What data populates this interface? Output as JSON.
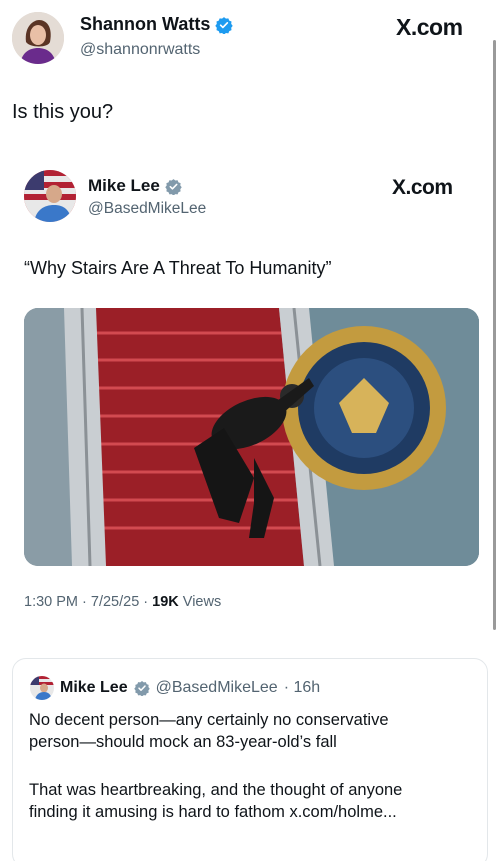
{
  "outer_post": {
    "display_name": "Shannon Watts",
    "handle": "@shannonrwatts",
    "site_logo": "X.com",
    "text": "Is this you?"
  },
  "quoted_post": {
    "display_name": "Mike Lee",
    "handle": "@BasedMikeLee",
    "site_logo": "X.com",
    "text": "“Why Stairs Are A Threat To Humanity”",
    "image_icon": "person-falling-on-stairs-image",
    "timestamp": "1:30 PM · 7/25/25 · ",
    "views_count": "19K",
    "views_label": " Views"
  },
  "reply": {
    "display_name": "Mike Lee",
    "handle": "@BasedMikeLee",
    "age": "· 16h",
    "paragraph1_line1": "No decent person—any certainly no conservative",
    "paragraph1_line2": "person—should mock an 83-year-old’s fall",
    "paragraph2_line1": "That was heartbreaking, and the thought of anyone",
    "paragraph2_line2": "finding it amusing is hard to fathom x.com/holme..."
  },
  "colors": {
    "verified_blue": "#1d9bf0",
    "verified_gray": "#829aab",
    "stairs_red": "#b02a30"
  }
}
